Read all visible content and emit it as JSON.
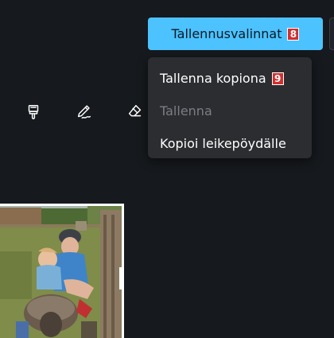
{
  "toolbar": {
    "save_options_label": "Tallennusvalinnat",
    "save_options_badge": "8",
    "tools": [
      {
        "icon": "brush-icon"
      },
      {
        "icon": "pen-icon"
      },
      {
        "icon": "eraser-icon"
      }
    ]
  },
  "save_menu": {
    "items": [
      {
        "label": "Tallenna kopiona",
        "badge": "9",
        "enabled": true
      },
      {
        "label": "Tallenna",
        "enabled": false
      },
      {
        "label": "Kopioi leikepöydälle",
        "enabled": true
      }
    ]
  },
  "colors": {
    "background": "#16191d",
    "accent": "#4cc2ff",
    "menu_background": "#2b2d31",
    "badge": "#d32f2f",
    "disabled_text": "#7a7d82"
  }
}
